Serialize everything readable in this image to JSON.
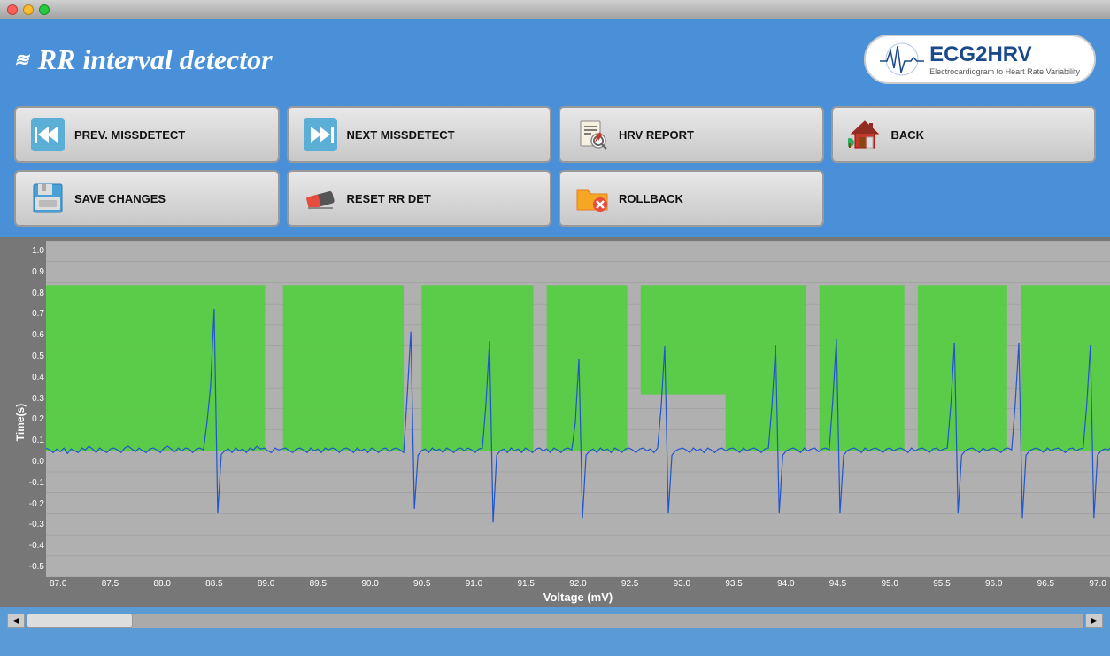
{
  "window": {
    "title": "RR interval detector"
  },
  "header": {
    "title": "RR interval detector",
    "logo_brand": "ECG2HRV",
    "logo_sub": "Electrocardiogram to Heart Rate Variability"
  },
  "toolbar": {
    "buttons": [
      {
        "id": "prev-missdetect",
        "label": "PREV. MISSDETECT",
        "icon": "rewind"
      },
      {
        "id": "next-missdetect",
        "label": "NEXT MISSDETECT",
        "icon": "fastforward"
      },
      {
        "id": "hrv-report",
        "label": "HRV REPORT",
        "icon": "report"
      },
      {
        "id": "back",
        "label": "BACK",
        "icon": "home"
      },
      {
        "id": "save-changes",
        "label": "SAVE CHANGES",
        "icon": "save"
      },
      {
        "id": "reset-rr",
        "label": "RESET RR DET",
        "icon": "eraser"
      },
      {
        "id": "rollback",
        "label": "ROLLBACK",
        "icon": "folder-x"
      }
    ]
  },
  "chart": {
    "y_axis_label": "Time(s)",
    "x_axis_label": "Voltage (mV)",
    "y_ticks": [
      "1.0",
      "0.9",
      "0.8",
      "0.7",
      "0.6",
      "0.5",
      "0.4",
      "0.3",
      "0.2",
      "0.1",
      "0.0",
      "-0.1",
      "-0.2",
      "-0.3",
      "-0.4",
      "-0.5"
    ],
    "x_ticks": [
      "87.0",
      "87.5",
      "88.0",
      "88.5",
      "89.0",
      "89.5",
      "90.0",
      "90.5",
      "91.0",
      "91.5",
      "92.0",
      "92.5",
      "93.0",
      "93.5",
      "94.0",
      "94.5",
      "95.0",
      "95.5",
      "96.0",
      "96.5",
      "97.0"
    ]
  }
}
